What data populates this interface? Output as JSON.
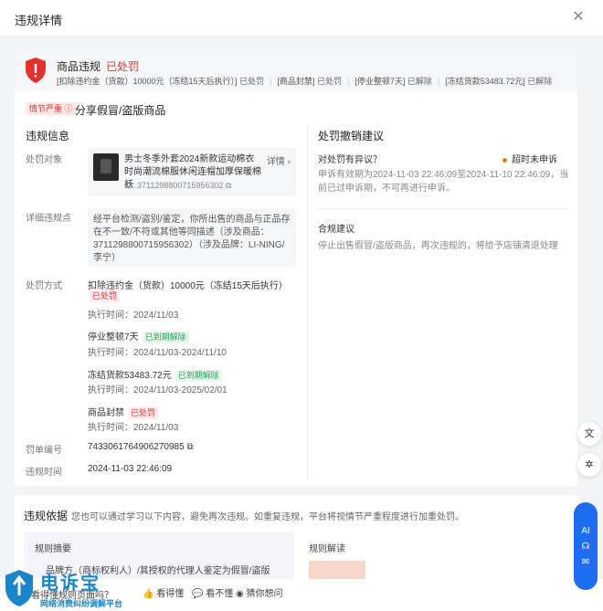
{
  "dialog": {
    "title": "违规详情"
  },
  "banner": {
    "title": "商品违规",
    "status": "已处罚",
    "penalties": [
      {
        "text": "[扣除违约金（货款）10000元（冻结15天后执行）]",
        "status": "已处罚"
      },
      {
        "text": "[商品封禁]",
        "status": "已处罚"
      },
      {
        "text": "[停业整顿7天]",
        "status": "已解除"
      },
      {
        "text": "[冻结货款53483.72元]",
        "status": "已解除"
      }
    ]
  },
  "severity": {
    "tag": "情节严重",
    "violation": "分享假冒/盗版商品"
  },
  "info": {
    "title": "违规信息",
    "target_label": "处罚对象",
    "product_name": "男士冬季外套2024新款运动棉衣时尚潮流棉服休闲连帽加厚保暖棉袄",
    "product_detail": "详情 ›",
    "product_id": "ID: 3711298800715956302",
    "detail_label": "详细违规点",
    "detail_text": "经平台检测/盗别/鉴定，你所出售的商品与正品存在不一致/不符或其他等同描述（涉及商品：3711298800715956302）（涉及品牌：LI-NING/李宁）",
    "method_label": "处罚方式",
    "methods": [
      {
        "text": "扣除违约金（货款）10000元（冻结15天后执行）",
        "tag": "已处罚",
        "time": "执行时间：2024/11/03"
      },
      {
        "text": "停业整顿7天",
        "tag": "已到期解除",
        "time": "执行时间：2024/11/03-2024/11/10"
      },
      {
        "text": "冻结货款53483.72元",
        "tag": "已到期解除",
        "time": "执行时间：2024/11/03-2025/02/01"
      },
      {
        "text": "商品封禁",
        "tag": "已处罚",
        "time": "执行时间：2024/11/03"
      }
    ],
    "ticket_label": "罚单编号",
    "ticket_no": "7433061764906270985",
    "time_label": "违规时间",
    "time_value": "2024-11-03 22:46:09"
  },
  "appeal": {
    "title": "处罚撤销建议",
    "question": "对处罚有异议？",
    "status": "超时未申诉",
    "desc": "申诉有效期为2024-11-03 22:46:09至2024-11-10 22:46:09，当前已过申诉期，不可再进行申诉。",
    "compliance_title": "合规建议",
    "compliance_text": "停止出售假冒/盗版商品，再次违规的，将给予店铺清退处理"
  },
  "basis": {
    "title": "违规依据",
    "desc": "您也可以通过学习以下内容，避免再次违规。如重复违规，平台将视情节严重程度进行加重处罚。",
    "summary_title": "规则摘要",
    "summary_item": "品牌方（商标权利人）/其授权的代理人鉴定为假冒/盗版",
    "interp_title": "规则解读"
  },
  "footer": {
    "prompt": "看得懂规则页面吗？",
    "btn_understand": "看得懂",
    "btn_not_understand": "看不懂",
    "btn_guess": "猜你想问"
  },
  "watermark": {
    "title": "电诉宝",
    "sub": "网络消费纠纷调解平台"
  },
  "side": {
    "ai": "AI"
  },
  "colors": {
    "accent_red": "#e3322e",
    "accent_green": "#2aa55a",
    "brand_blue": "#1a86c9"
  }
}
